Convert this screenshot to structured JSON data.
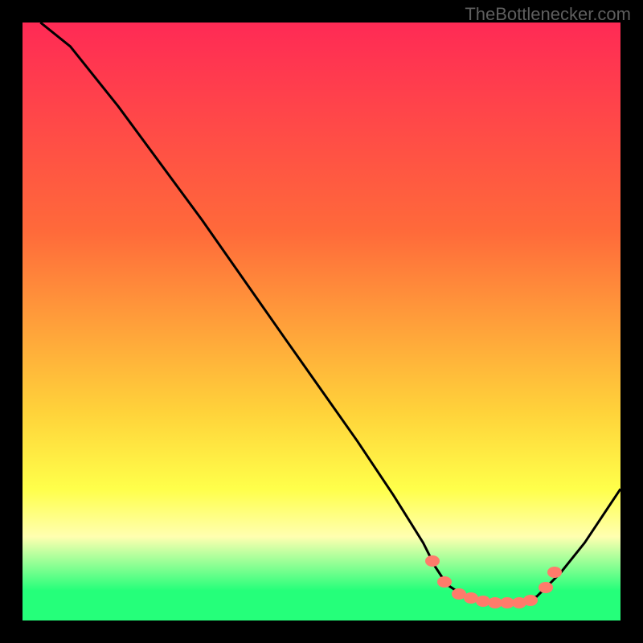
{
  "watermark": "TheBottlenecker.com",
  "colors": {
    "top": "#ff2a55",
    "mid_upper": "#ff6a3a",
    "mid": "#ffd23a",
    "mid_lower": "#ffff4a",
    "zone_pale": "#ffffb0",
    "zone_green": "#25ff7a",
    "dot": "#ff7b6b",
    "curve": "#000000"
  },
  "chart_data": {
    "type": "line",
    "title": "",
    "xlabel": "",
    "ylabel": "",
    "xlim": [
      0,
      100
    ],
    "ylim": [
      0,
      100
    ],
    "curve": [
      {
        "x": 3,
        "y": 100
      },
      {
        "x": 8,
        "y": 96
      },
      {
        "x": 16,
        "y": 86
      },
      {
        "x": 30,
        "y": 67
      },
      {
        "x": 44,
        "y": 47
      },
      {
        "x": 56,
        "y": 30
      },
      {
        "x": 62,
        "y": 21
      },
      {
        "x": 67,
        "y": 13
      },
      {
        "x": 69,
        "y": 9
      },
      {
        "x": 71,
        "y": 6
      },
      {
        "x": 74,
        "y": 4
      },
      {
        "x": 78,
        "y": 3
      },
      {
        "x": 82,
        "y": 3
      },
      {
        "x": 86,
        "y": 4
      },
      {
        "x": 88,
        "y": 6
      },
      {
        "x": 90,
        "y": 8
      },
      {
        "x": 94,
        "y": 13
      },
      {
        "x": 100,
        "y": 22
      }
    ],
    "dots": [
      {
        "x": 68.5,
        "y": 10
      },
      {
        "x": 70.5,
        "y": 6.5
      },
      {
        "x": 73,
        "y": 4.5
      },
      {
        "x": 75,
        "y": 3.8
      },
      {
        "x": 77,
        "y": 3.2
      },
      {
        "x": 79,
        "y": 3.0
      },
      {
        "x": 81,
        "y": 3.0
      },
      {
        "x": 83,
        "y": 3.0
      },
      {
        "x": 85,
        "y": 3.4
      },
      {
        "x": 87.5,
        "y": 5.5
      },
      {
        "x": 89,
        "y": 8
      }
    ],
    "gradient_stops_y_pct": {
      "red_top": 0,
      "orange": 35,
      "yellow": 65,
      "pale_yellow_start": 78,
      "pale_band": 86,
      "green_band_start": 95,
      "green_band_end": 100
    }
  }
}
